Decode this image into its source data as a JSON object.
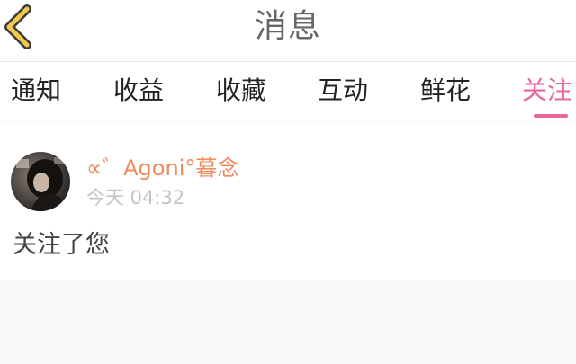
{
  "header": {
    "title": "消息",
    "back_icon": "chevron-left-icon",
    "back_color": "#f2c94c"
  },
  "tabs": [
    {
      "label": "通知",
      "active": false
    },
    {
      "label": "收益",
      "active": false
    },
    {
      "label": "收藏",
      "active": false
    },
    {
      "label": "互动",
      "active": false
    },
    {
      "label": "鲜花",
      "active": false
    },
    {
      "label": "关注",
      "active": true
    }
  ],
  "notification": {
    "user_name": "∝゛Agoni°暮念",
    "time": "今天 04:32",
    "message": "关注了您",
    "avatar_icon": "user-avatar"
  },
  "colors": {
    "accent": "#e8679c",
    "username": "#f08a5d",
    "muted": "#c4c4c4"
  }
}
